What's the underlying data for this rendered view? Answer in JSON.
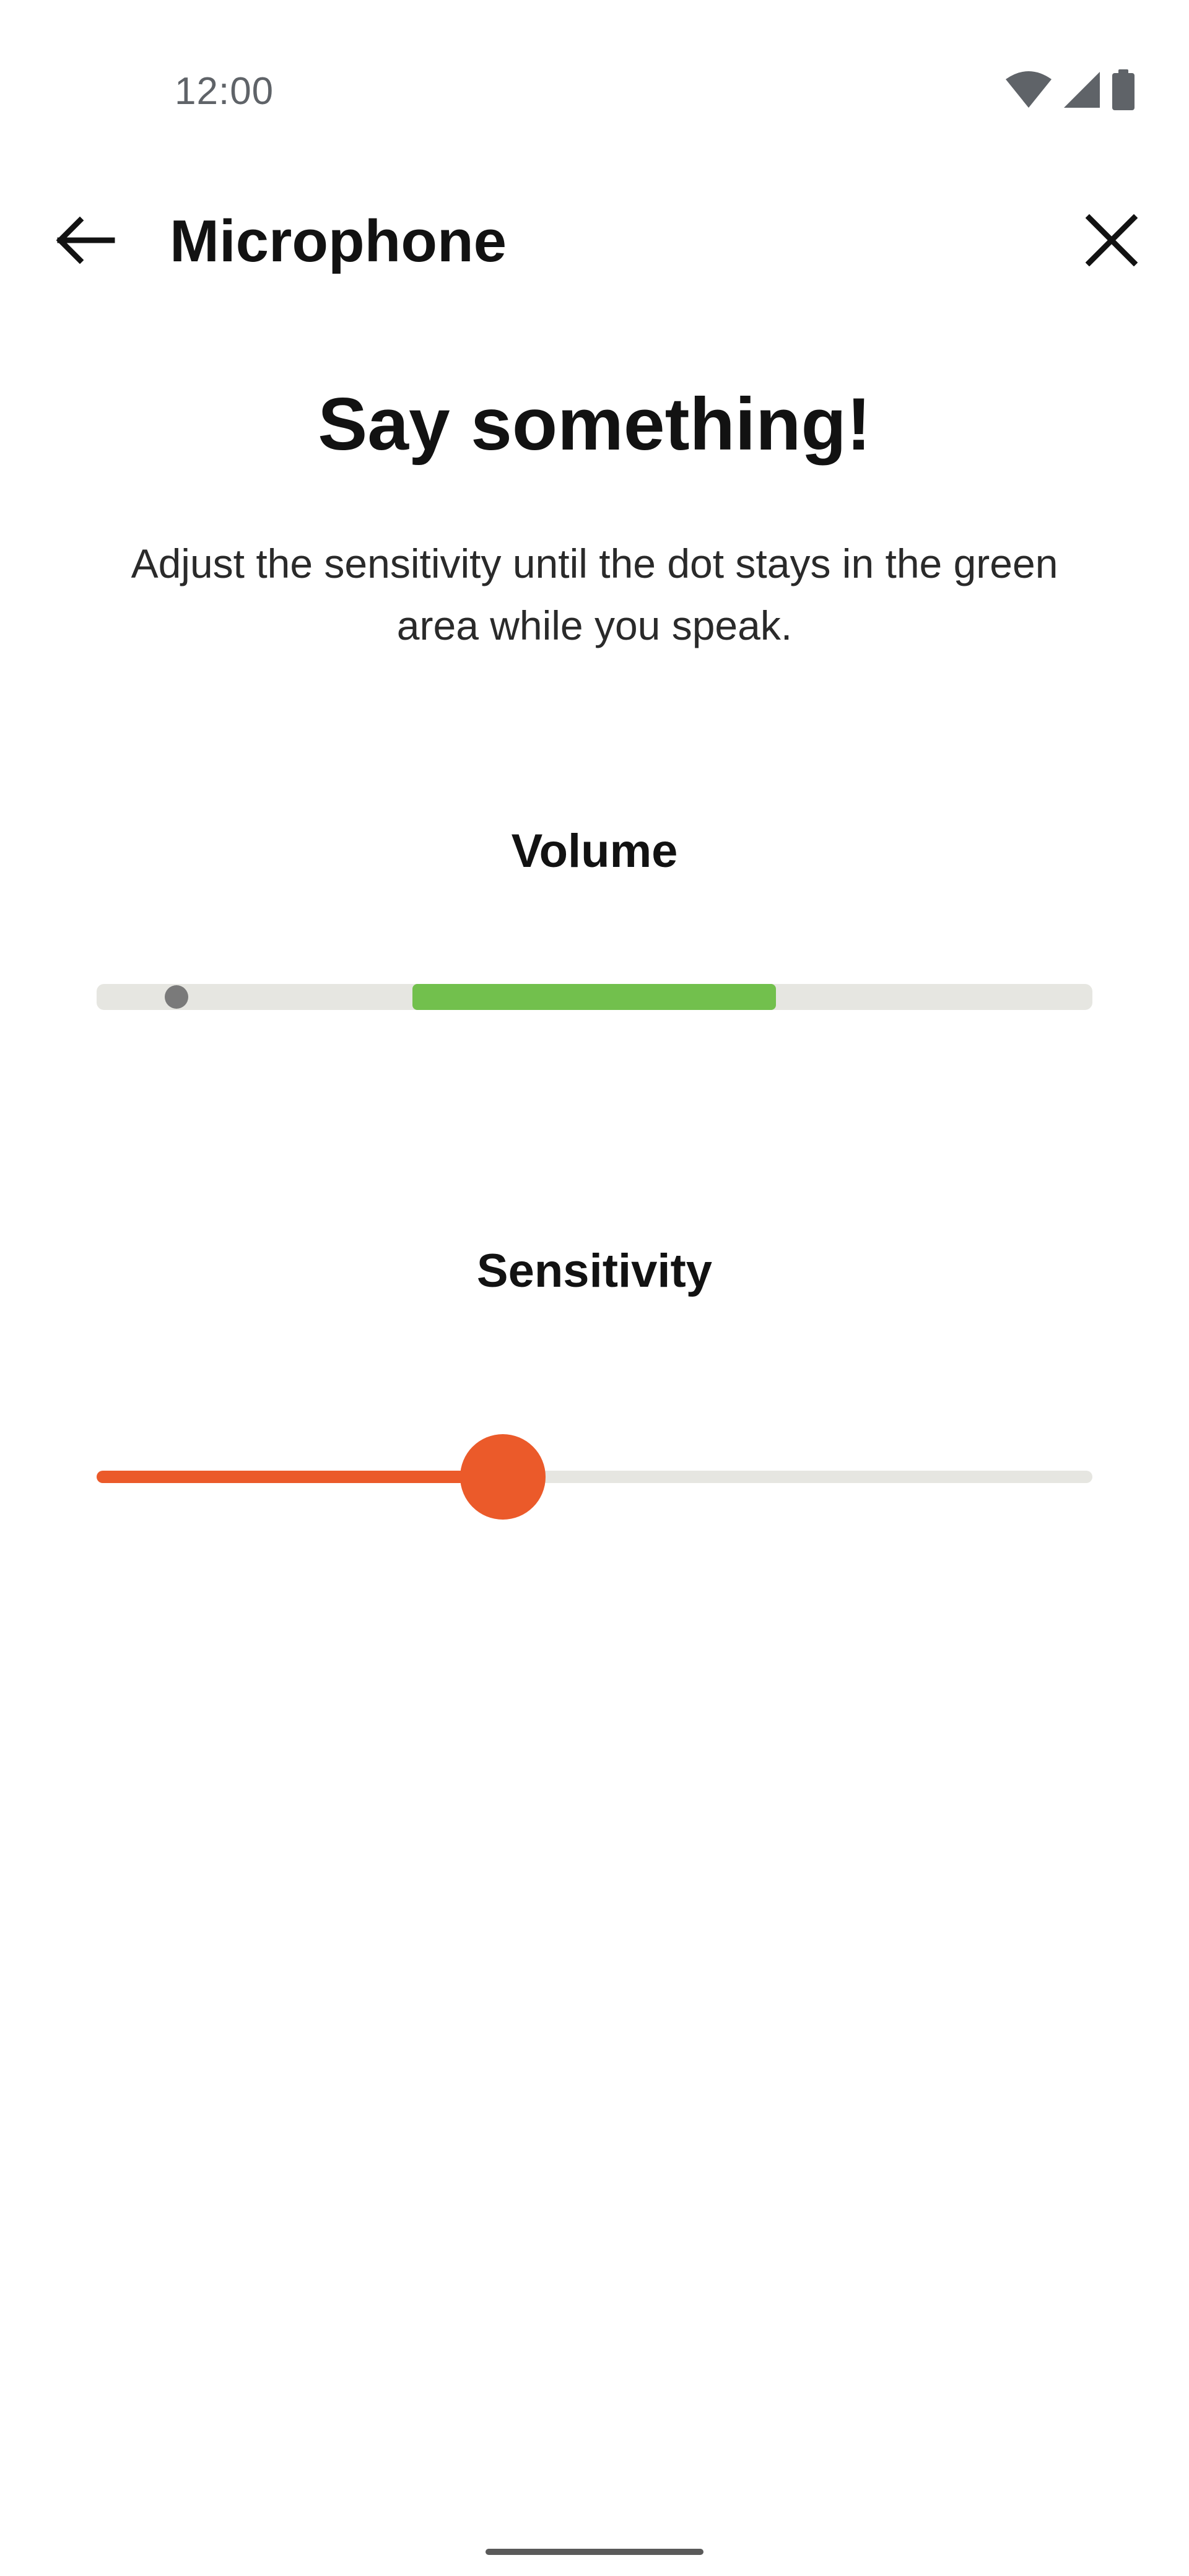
{
  "status_bar": {
    "time": "12:00",
    "icons": [
      "wifi-icon",
      "cell-signal-icon",
      "battery-icon"
    ]
  },
  "app_bar": {
    "title": "Microphone",
    "back_icon": "arrow-left-icon",
    "close_icon": "close-icon"
  },
  "main": {
    "headline": "Say something!",
    "instructions": "Adjust the sensitivity until the dot stays in the green area while you speak.",
    "volume": {
      "label": "Volume",
      "level": 0.08,
      "target_range": [
        0.317,
        0.682
      ]
    },
    "sensitivity": {
      "label": "Sensitivity",
      "value": 0.408
    }
  },
  "colors": {
    "track": "#e6e6e1",
    "target_green": "#72c04d",
    "accent_orange": "#eb5a2a",
    "volume_dot": "#7a7a7a",
    "text_primary": "#121212"
  }
}
